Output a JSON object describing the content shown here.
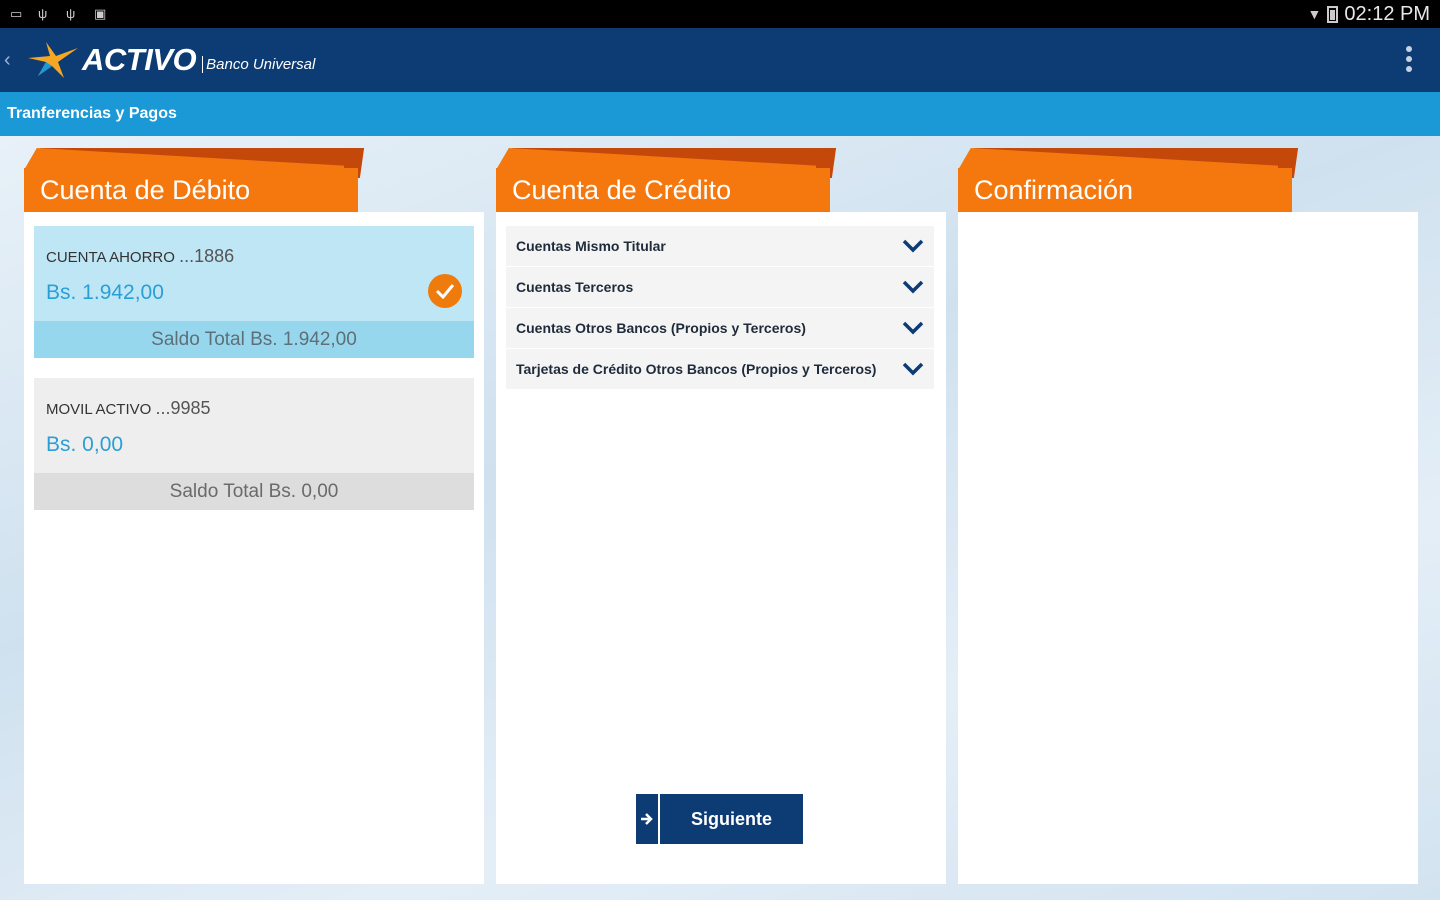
{
  "status_bar": {
    "time": "02:12 PM"
  },
  "header": {
    "brand": "ACTIVO",
    "brand_sub": "Banco Universal",
    "accent_color": "#0d3b73"
  },
  "breadcrumb": {
    "label": "Tranferencias y Pagos"
  },
  "columns": [
    {
      "title": "Cuenta de Débito"
    },
    {
      "title": "Cuenta de Crédito"
    },
    {
      "title": "Confirmación"
    }
  ],
  "debit_accounts": [
    {
      "name": "CUENTA AHORRO",
      "number": "...1886",
      "amount": "Bs. 1.942,00",
      "total": "Saldo Total Bs. 1.942,00",
      "selected": true
    },
    {
      "name": "MOVIL ACTIVO",
      "number": "...9985",
      "amount": "Bs. 0,00",
      "total": "Saldo Total Bs. 0,00",
      "selected": false
    }
  ],
  "credit_options": [
    {
      "label": "Cuentas Mismo Titular"
    },
    {
      "label": "Cuentas Terceros"
    },
    {
      "label": "Cuentas Otros Bancos (Propios y Terceros)"
    },
    {
      "label": "Tarjetas de Crédito Otros Bancos (Propios y Terceros)"
    }
  ],
  "actions": {
    "next_label": "Siguiente"
  }
}
